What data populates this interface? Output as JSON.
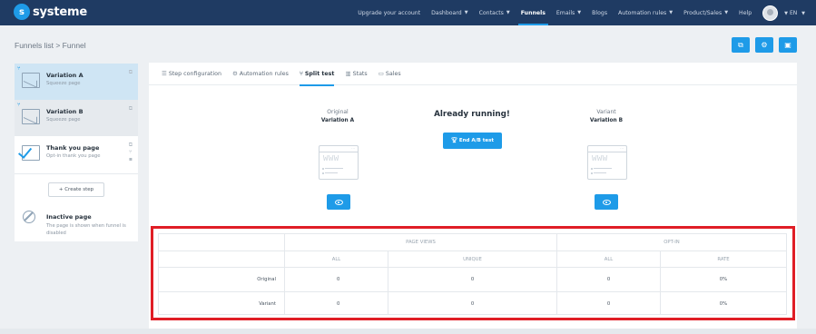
{
  "app": {
    "logo_text": "systeme",
    "logo_letter": "s"
  },
  "nav": {
    "items": [
      {
        "label": "Upgrade your account",
        "caret": false,
        "active": false
      },
      {
        "label": "Dashboard",
        "caret": true,
        "active": false
      },
      {
        "label": "Contacts",
        "caret": true,
        "active": false
      },
      {
        "label": "Funnels",
        "caret": false,
        "active": true
      },
      {
        "label": "Emails",
        "caret": true,
        "active": false
      },
      {
        "label": "Blogs",
        "caret": false,
        "active": false
      },
      {
        "label": "Automation rules",
        "caret": true,
        "active": false
      },
      {
        "label": "Product/Sales",
        "caret": true,
        "active": false
      },
      {
        "label": "Help",
        "caret": false,
        "active": false
      }
    ],
    "language": "EN"
  },
  "breadcrumb": "Funnels list > Funnel",
  "sidebar": {
    "steps": [
      {
        "title": "Variation A",
        "subtitle": "Squeeze page"
      },
      {
        "title": "Variation B",
        "subtitle": "Squeeze page"
      },
      {
        "title": "Thank you page",
        "subtitle": "Opt-in thank you page"
      }
    ],
    "create_step_label": "+ Create step",
    "inactive": {
      "title": "Inactive page",
      "description": "The page is shown when funnel is disabled"
    }
  },
  "tabs": [
    {
      "icon": "☰",
      "label": "Step configuration",
      "active": false
    },
    {
      "icon": "⚙",
      "label": "Automation rules",
      "active": false
    },
    {
      "icon": "⑂",
      "label": "Split test",
      "active": true
    },
    {
      "icon": "▥",
      "label": "Stats",
      "active": false
    },
    {
      "icon": "▭",
      "label": "Sales",
      "active": false
    }
  ],
  "split_test": {
    "original": {
      "label": "Original",
      "name": "Variation A"
    },
    "variant": {
      "label": "Variant",
      "name": "Variation B"
    },
    "status": "Already running!",
    "end_button": "End A/B test",
    "www_text": "WWW"
  },
  "stats_table": {
    "group_headers": [
      "PAGE VIEWS",
      "OPT-IN"
    ],
    "sub_headers": [
      "ALL",
      "UNIQUE",
      "ALL",
      "RATE"
    ],
    "rows": [
      {
        "label": "Original",
        "values": [
          "0",
          "0",
          "0",
          "0%"
        ]
      },
      {
        "label": "Variant",
        "values": [
          "0",
          "0",
          "0",
          "0%"
        ]
      }
    ]
  },
  "colors": {
    "accent": "#1e9be8",
    "topbar": "#1f3b63",
    "highlight": "#e01e26"
  }
}
